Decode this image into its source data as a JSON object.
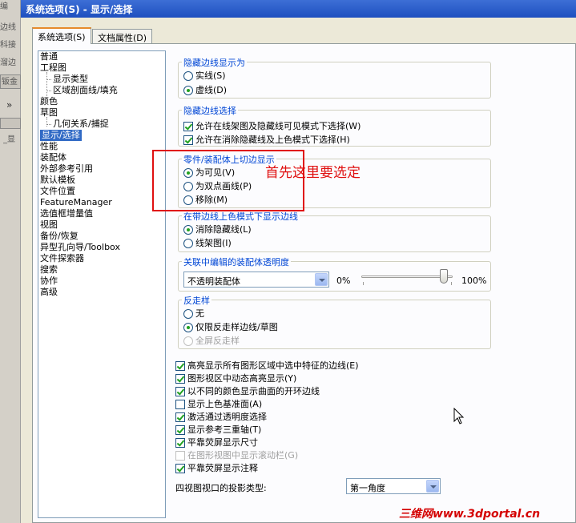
{
  "background_app": {
    "fragments": [
      "编",
      "边线",
      "科接",
      "溜边",
      "钣金",
      "_显"
    ]
  },
  "window": {
    "title": "系统选项(S) - 显示/选择"
  },
  "tabs": [
    {
      "label": "系统选项(S)",
      "active": true
    },
    {
      "label": "文档属性(D)",
      "active": false
    }
  ],
  "tree": {
    "items": [
      {
        "label": "普通",
        "level": 0
      },
      {
        "label": "工程图",
        "level": 0
      },
      {
        "label": "显示类型",
        "level": 1
      },
      {
        "label": "区域剖面线/填充",
        "level": 1
      },
      {
        "label": "颜色",
        "level": 0
      },
      {
        "label": "草图",
        "level": 0
      },
      {
        "label": "几何关系/捕捉",
        "level": 1
      },
      {
        "label": "显示/选择",
        "level": 0,
        "selected": true
      },
      {
        "label": "性能",
        "level": 0
      },
      {
        "label": "装配体",
        "level": 0
      },
      {
        "label": "外部参考引用",
        "level": 0
      },
      {
        "label": "默认模板",
        "level": 0
      },
      {
        "label": "文件位置",
        "level": 0
      },
      {
        "label": "FeatureManager",
        "level": 0
      },
      {
        "label": "选值框增量值",
        "level": 0
      },
      {
        "label": "视图",
        "level": 0
      },
      {
        "label": "备份/恢复",
        "level": 0
      },
      {
        "label": "异型孔向导/Toolbox",
        "level": 0
      },
      {
        "label": "文件探索器",
        "level": 0
      },
      {
        "label": "搜索",
        "level": 0
      },
      {
        "label": "协作",
        "level": 0
      },
      {
        "label": "高级",
        "level": 0
      }
    ]
  },
  "hidden_edges_display": {
    "title": "隐藏边线显示为",
    "options": [
      "实线(S)",
      "虚线(D)"
    ],
    "selected": 1
  },
  "hidden_edges_select": {
    "title": "隐藏边线选择",
    "options": [
      {
        "label": "允许在线架图及隐藏线可见模式下选择(W)",
        "checked": true
      },
      {
        "label": "允许在消除隐藏线及上色模式下选择(H)",
        "checked": true
      }
    ]
  },
  "part_assembly_tangent": {
    "title": "零件/装配体上切边显示",
    "options": [
      "为可见(V)",
      "为双点画线(P)",
      "移除(M)"
    ],
    "selected": 0
  },
  "shaded_edges": {
    "title": "在带边线上色模式下显示边线",
    "options": [
      "消除隐藏线(L)",
      "线架图(I)"
    ],
    "selected": 0
  },
  "transparency": {
    "title": "关联中编辑的装配体透明度",
    "select_value": "不透明装配体",
    "min_label": "0%",
    "max_label": "100%",
    "slider_percent": 0.9
  },
  "antialias": {
    "title": "反走样",
    "options": [
      {
        "label": "无",
        "disabled": false
      },
      {
        "label": "仅限反走样边线/草图",
        "disabled": false
      },
      {
        "label": "全屏反走样",
        "disabled": true
      }
    ],
    "selected": 1
  },
  "checkboxes": [
    {
      "label": "高亮显示所有图形区域中选中特征的边线(E)",
      "checked": true,
      "disabled": false
    },
    {
      "label": "图形视区中动态高亮显示(Y)",
      "checked": true,
      "disabled": false
    },
    {
      "label": "以不同的颜色显示曲面的开环边线",
      "checked": true,
      "disabled": false
    },
    {
      "label": "显示上色基准面(A)",
      "checked": false,
      "disabled": false
    },
    {
      "label": "激活通过透明度选择",
      "checked": true,
      "disabled": false
    },
    {
      "label": "显示参考三重轴(T)",
      "checked": true,
      "disabled": false
    },
    {
      "label": "平靠荧屏显示尺寸",
      "checked": true,
      "disabled": false
    },
    {
      "label": "在图形视图中显示滚动栏(G)",
      "checked": false,
      "disabled": true
    },
    {
      "label": "平靠荧屏显示注释",
      "checked": true,
      "disabled": false
    }
  ],
  "projection": {
    "label": "四视图视口的投影类型:",
    "value": "第一角度"
  },
  "annotation": {
    "text": "首先这里要选定",
    "color": "#e01010"
  },
  "watermark": {
    "text": "三维网www.3dportal.cn",
    "color": "#d40000"
  },
  "colors": {
    "selection": "#316ac5",
    "group_title": "#0046d5",
    "titlebar": "#1e4fbf"
  }
}
